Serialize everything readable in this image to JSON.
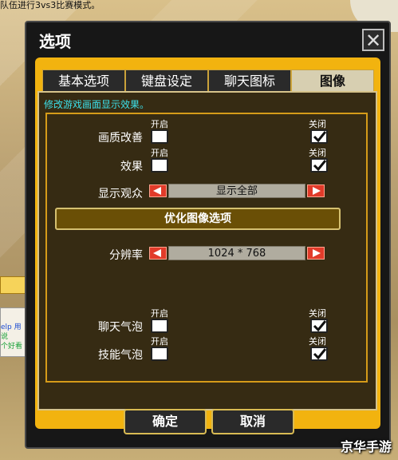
{
  "background": {
    "top_text": "队伍进行3vs3比赛模式。",
    "left_texts": [
      "elp 用",
      "说",
      "个好看"
    ],
    "watermark": "京华手游"
  },
  "dialog": {
    "title": "选项",
    "close_symbol": "✕",
    "tabs": [
      {
        "label": "基本选项"
      },
      {
        "label": "键盘设定"
      },
      {
        "label": "聊天图标"
      },
      {
        "label": "图像"
      }
    ],
    "active_tab": "图像",
    "description": "修改游戏画面显示效果。",
    "toggles": [
      {
        "label": "画质改善",
        "on": "开启",
        "off": "关闭",
        "selected": "关闭"
      },
      {
        "label": "效果",
        "on": "开启",
        "off": "关闭",
        "selected": "关闭"
      }
    ],
    "audience": {
      "label": "显示观众",
      "value": "显示全部"
    },
    "optimize_button": "优化图像选项",
    "resolution": {
      "label": "分辨率",
      "value": "1024 * 768"
    },
    "bubbles": [
      {
        "label": "聊天气泡",
        "on": "开启",
        "off": "关闭",
        "selected": "关闭"
      },
      {
        "label": "技能气泡",
        "on": "开启",
        "off": "关闭",
        "selected": "关闭"
      }
    ],
    "confirm_label": "确定",
    "cancel_label": "取消"
  }
}
